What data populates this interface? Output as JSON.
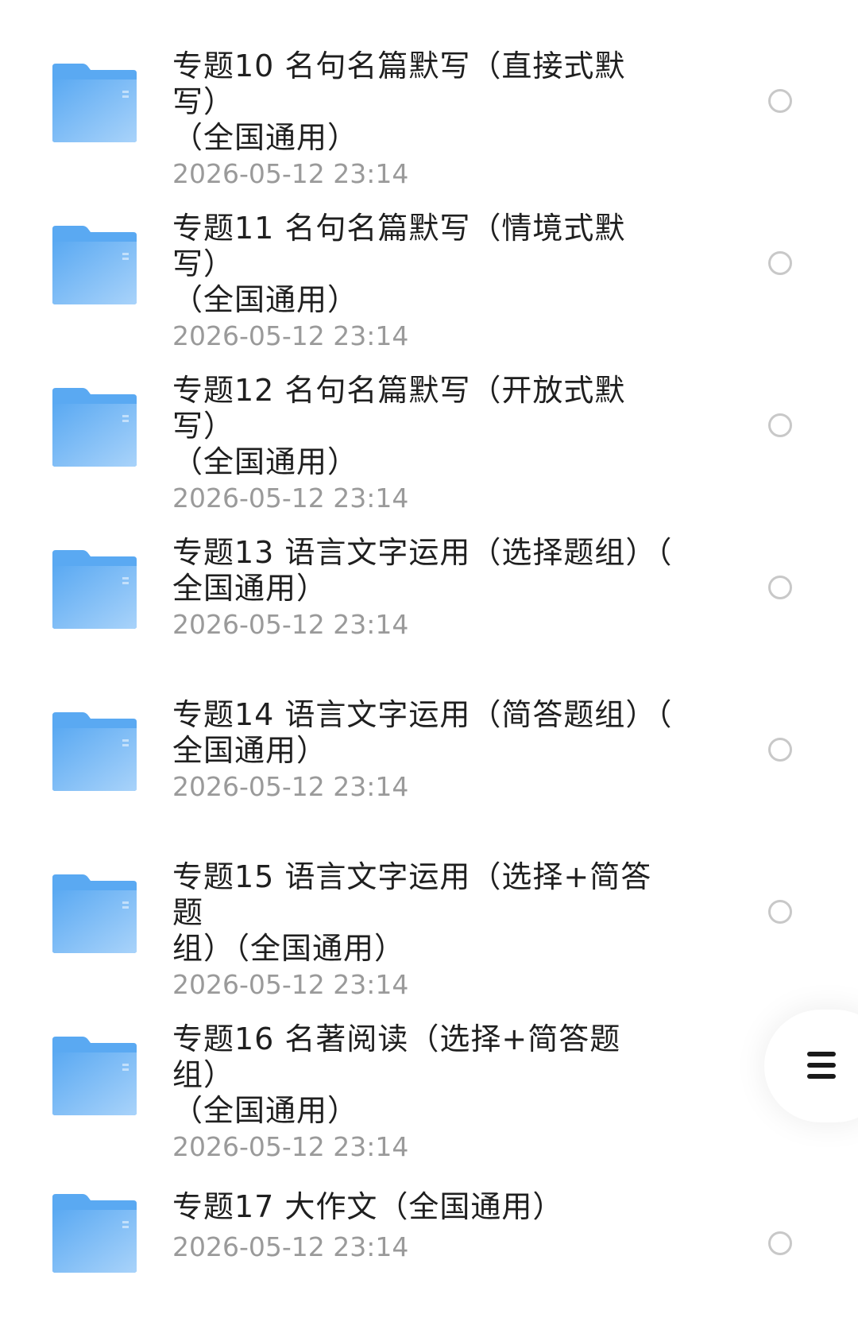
{
  "files": [
    {
      "name": "专题10 名句名篇默写（直接式默写）\n（全国通用）",
      "date": "2026-05-12 23:14",
      "icon": "folder-icon",
      "selected": false
    },
    {
      "name": "专题11 名句名篇默写（情境式默写）\n（全国通用）",
      "date": "2026-05-12 23:14",
      "icon": "folder-icon",
      "selected": false
    },
    {
      "name": "专题12 名句名篇默写（开放式默写）\n（全国通用）",
      "date": "2026-05-12 23:14",
      "icon": "folder-icon",
      "selected": false
    },
    {
      "name": "专题13 语言文字运用（选择题组）（\n全国通用）",
      "date": "2026-05-12 23:14",
      "icon": "folder-icon",
      "selected": false
    },
    {
      "name": "专题14 语言文字运用（简答题组）（\n全国通用）",
      "date": "2026-05-12 23:14",
      "icon": "folder-icon",
      "selected": false
    },
    {
      "name": "专题15 语言文字运用（选择+简答题\n组）（全国通用）",
      "date": "2026-05-12 23:14",
      "icon": "folder-icon",
      "selected": false
    },
    {
      "name": "专题16 名著阅读（选择+简答题组）\n（全国通用）",
      "date": "2026-05-12 23:14",
      "icon": "folder-icon",
      "selected": false
    },
    {
      "name": "专题17 大作文（全国通用）",
      "date": "2026-05-12 23:14",
      "icon": "folder-icon",
      "selected": false
    }
  ],
  "fab": {
    "icon": "menu-icon"
  },
  "colors": {
    "folder_blue": "#6cb6f5",
    "title_text": "#1f1f1f",
    "date_text": "#9a9a9a",
    "radio_border": "#c8c8c8"
  }
}
